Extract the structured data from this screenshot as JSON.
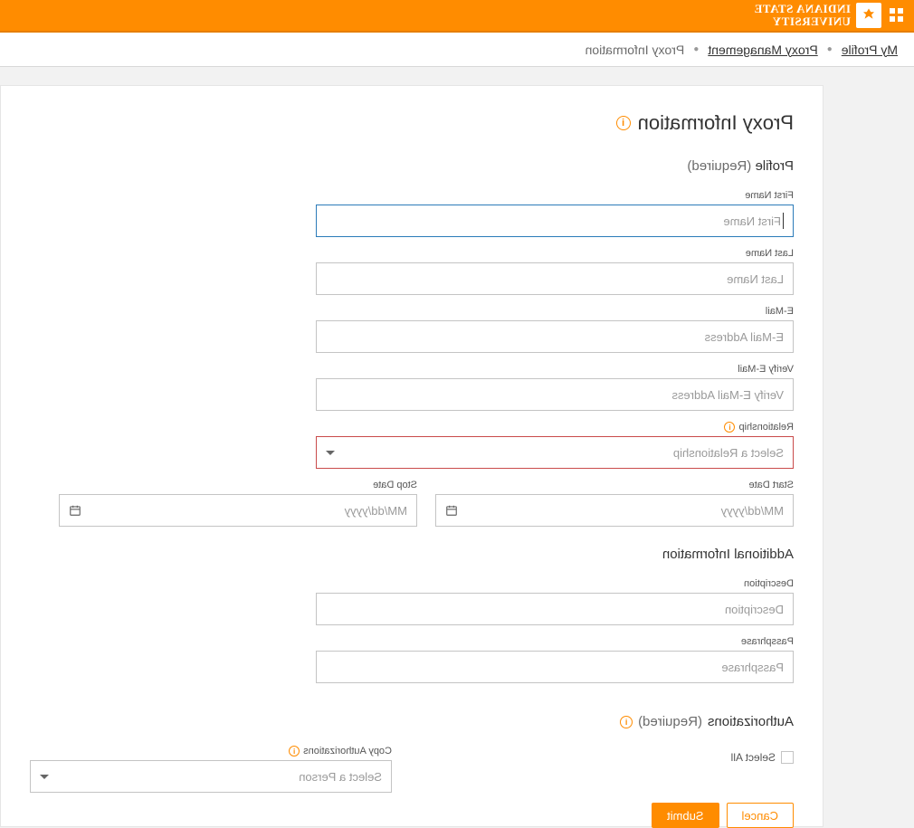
{
  "header": {
    "uni_line1": "INDIANA STATE",
    "uni_line2": "UNIVERSITY"
  },
  "breadcrumb": {
    "my_profile": "My Profile",
    "proxy_management": "Proxy Management",
    "proxy_information": "Proxy Information"
  },
  "page": {
    "title": "Proxy Information"
  },
  "sections": {
    "profile": {
      "label": "Profile",
      "required": "(Required)"
    },
    "additional": {
      "label": "Additional Information"
    },
    "authorizations": {
      "label": "Authorizations",
      "required": "(Required)"
    }
  },
  "fields": {
    "first_name": {
      "label": "First Name",
      "placeholder": "First Name"
    },
    "last_name": {
      "label": "Last Name",
      "placeholder": "Last Name"
    },
    "email": {
      "label": "E-Mail",
      "placeholder": "E-Mail Address"
    },
    "verify_email": {
      "label": "Verify E-Mail",
      "placeholder": "Verify E-Mail Address"
    },
    "relationship": {
      "label": "Relationship",
      "placeholder": "Select a Relationship"
    },
    "start_date": {
      "label": "Start Date",
      "placeholder": "MM/dd/yyyy"
    },
    "stop_date": {
      "label": "Stop Date",
      "placeholder": "MM/dd/yyyy"
    },
    "description": {
      "label": "Description",
      "placeholder": "Description"
    },
    "passphrase": {
      "label": "Passphrase",
      "placeholder": "Passphrase"
    },
    "select_all": {
      "label": "Select All"
    },
    "copy_auth": {
      "label": "Copy Authorizations",
      "placeholder": "Select a Person"
    }
  },
  "buttons": {
    "cancel": "Cancel",
    "submit": "Submit"
  }
}
